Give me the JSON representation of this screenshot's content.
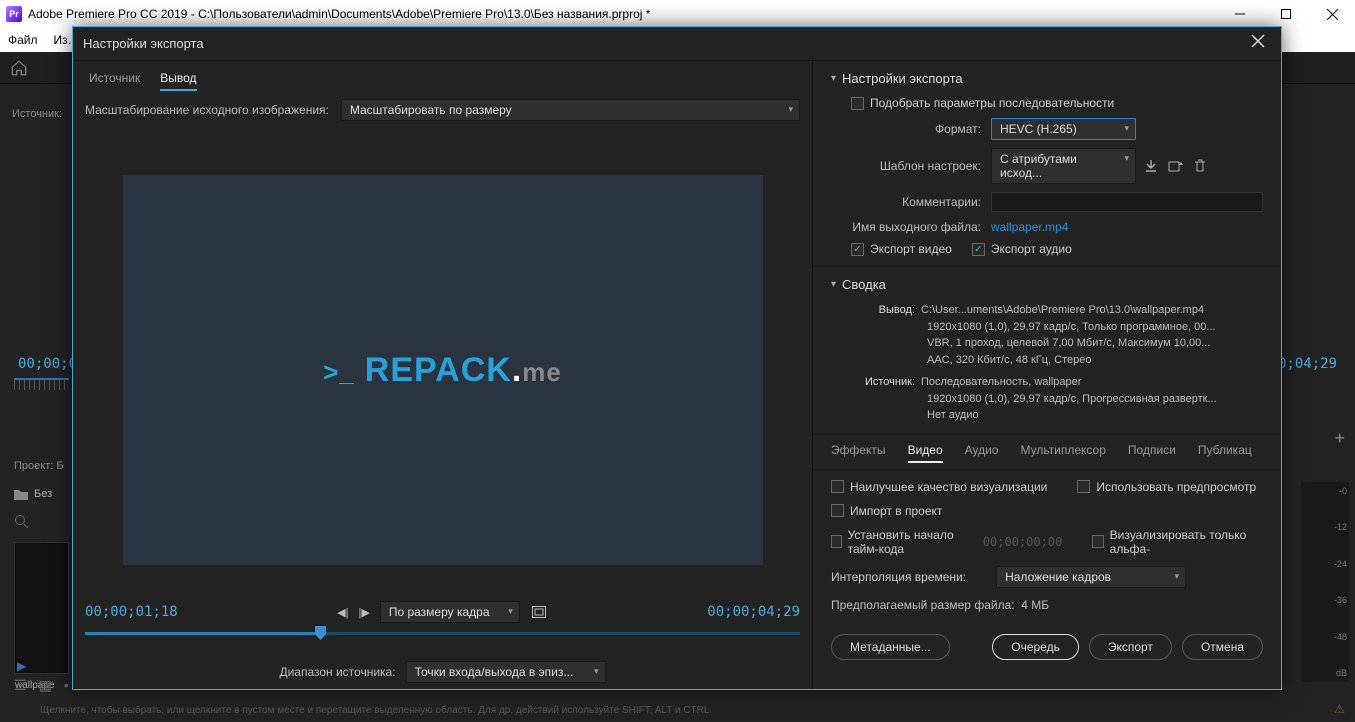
{
  "window": {
    "app_badge": "Pr",
    "title": "Adobe Premiere Pro CC 2019 - C:\\Пользователи\\admin\\Documents\\Adobe\\Premiere Pro\\13.0\\Без названия.prproj *"
  },
  "menubar": {
    "file": "Файл",
    "edit_trunc": "Из…"
  },
  "background": {
    "source_label": "Источник:",
    "tc_left": "00;00;0",
    "tc_right": "0;04;29",
    "project_label": "Проект: Б",
    "bin_label": "Без",
    "thumb_caption": "wallpape",
    "hint": "Щелкните, чтобы выбрать, или щелкните в пустом месте и перетащите выделенную область. Для др. действий используйте SHIFT, ALT и CTRL.",
    "meters": [
      "-0",
      "-12",
      "-24",
      "-36",
      "-48",
      "dB"
    ]
  },
  "dialog": {
    "title": "Настройки экспорта",
    "left": {
      "tabs": {
        "source": "Источник",
        "output": "Вывод"
      },
      "scale_label": "Масштабирование исходного изображения:",
      "scale_value": "Масштабировать по размеру",
      "logo": {
        "prefix": ">_",
        "brand_blue": "REPACK",
        "dot": ".",
        "brand_gray": "me"
      },
      "tc_in": "00;00;01;18",
      "tc_out": "00;00;04;29",
      "fit_dd": "По размеру кадра",
      "range_label": "Диапазон источника:",
      "range_value": "Точки входа/выхода в эпиз..."
    },
    "right": {
      "section_title": "Настройки экспорта",
      "match_seq": "Подобрать параметры последовательности",
      "format_label": "Формат:",
      "format_value": "HEVC (H.265)",
      "preset_label": "Шаблон настроек:",
      "preset_value": "С атрибутами исход...",
      "comments_label": "Комментарии:",
      "outname_label": "Имя выходного файла:",
      "outname_value": "wallpaper.mp4",
      "export_video": "Экспорт видео",
      "export_audio": "Экспорт аудио",
      "summary_title": "Сводка",
      "summary": {
        "out_label": "Вывод:",
        "out_lines": [
          "C:\\User...uments\\Adobe\\Premiere Pro\\13.0\\wallpaper.mp4",
          "1920x1080 (1,0), 29,97 кадр/с, Только программное, 00...",
          "VBR, 1 проход, целевой 7,00 Мбит/с, Максимум 10,00...",
          "AAC, 320 Кбит/с, 48 кГц, Стерео"
        ],
        "src_label": "Источник:",
        "src_lines": [
          "Последовательность, wallpaper",
          "1920x1080 (1,0), 29,97 кадр/с, Прогрессивная развертк...",
          "Нет аудио"
        ]
      },
      "tabs": {
        "effects": "Эффекты",
        "video": "Видео",
        "audio": "Аудио",
        "mux": "Мультиплексор",
        "captions": "Подписи",
        "publish": "Публикац"
      },
      "opts": {
        "max_render": "Наилучшее качество визуализации",
        "use_preview": "Использовать предпросмотр",
        "import_project": "Импорт в проект",
        "set_tc": "Установить начало тайм-кода",
        "tc_value": "00;00;00;00",
        "alpha_only": "Визуализировать только альфа-",
        "interp_label": "Интерполяция времени:",
        "interp_value": "Наложение кадров",
        "est_prefix": "Предполагаемый размер файла:",
        "est_value": "4 МБ"
      },
      "buttons": {
        "metadata": "Метаданные...",
        "queue": "Очередь",
        "export": "Экспорт",
        "cancel": "Отмена"
      }
    }
  }
}
